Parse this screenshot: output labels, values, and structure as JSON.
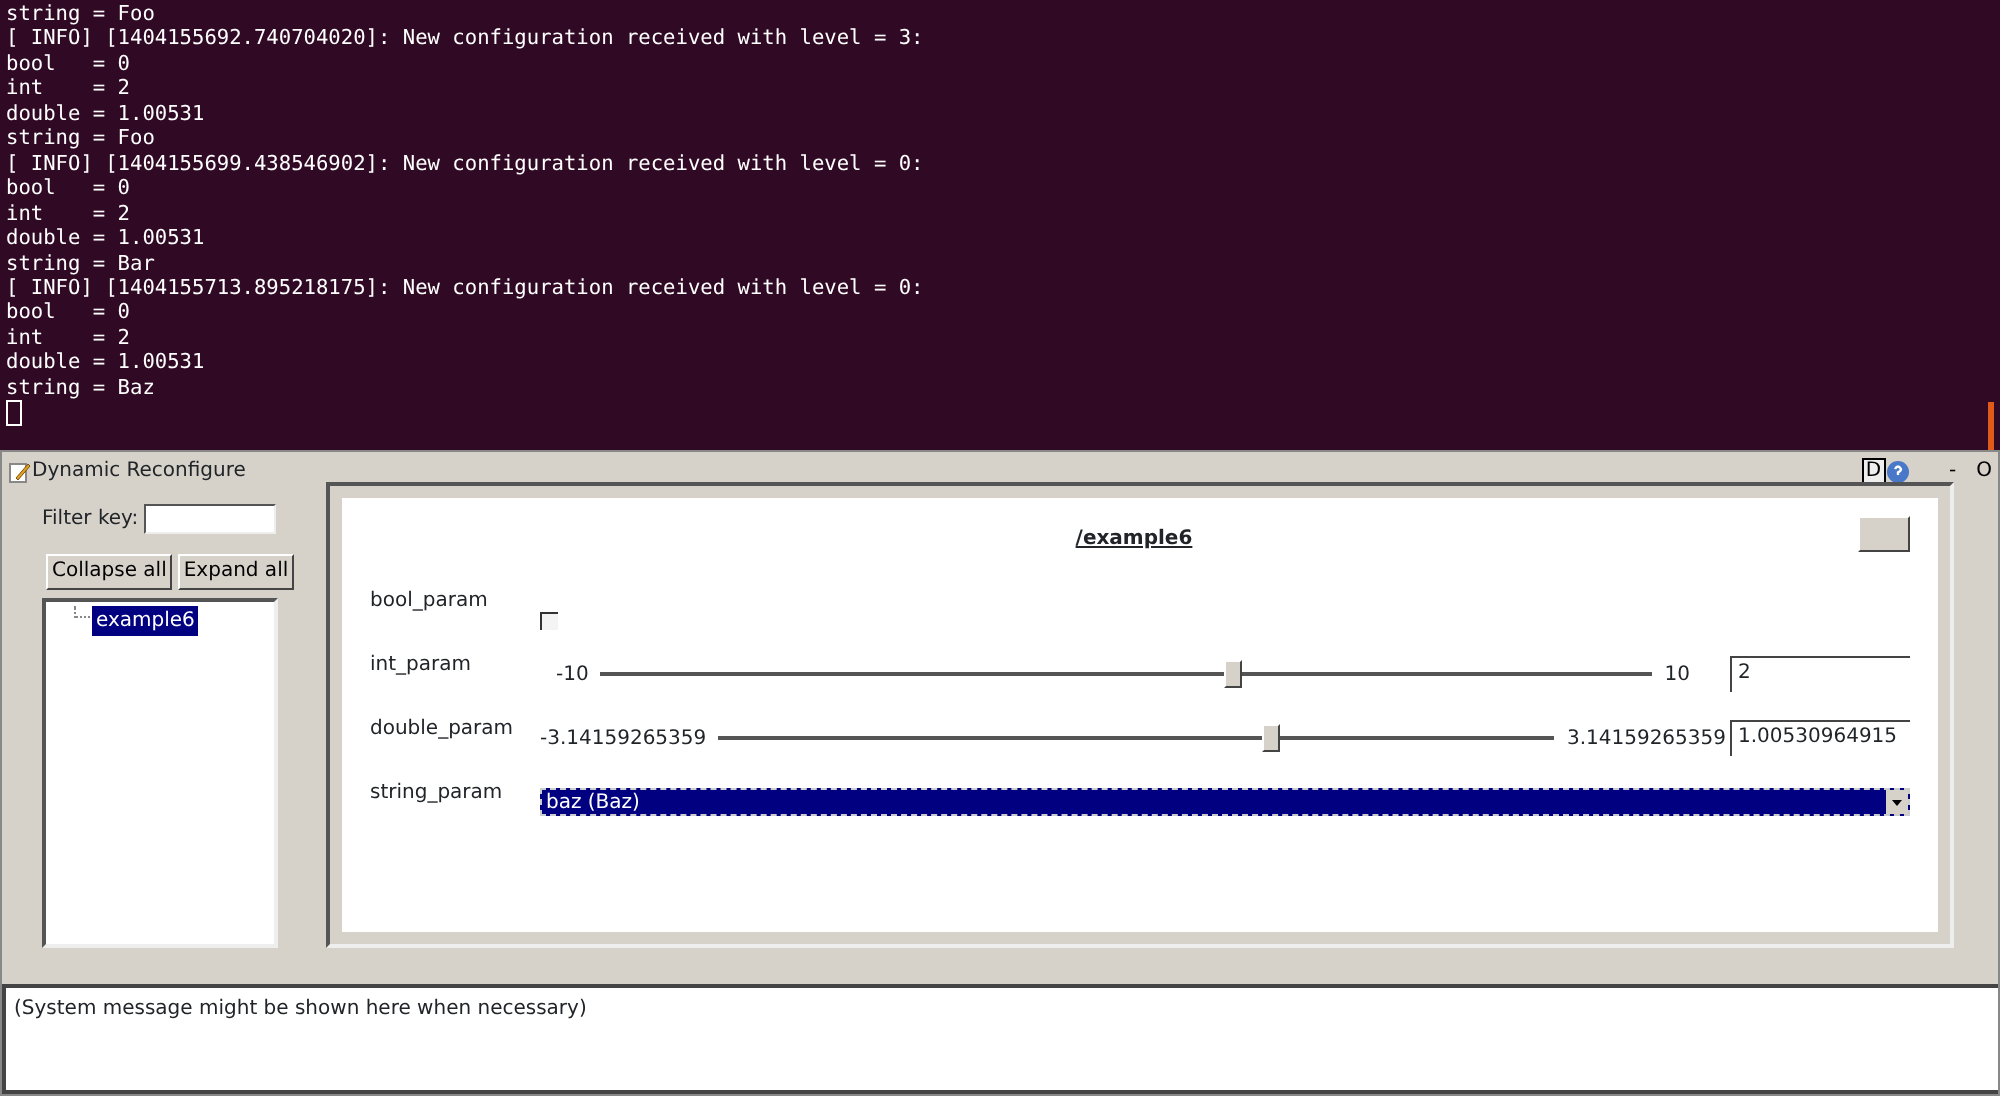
{
  "terminal": {
    "lines": [
      "string = Foo",
      "[ INFO] [1404155692.740704020]: New configuration received with level = 3:",
      "bool   = 0",
      "int    = 2",
      "double = 1.00531",
      "string = Foo",
      "[ INFO] [1404155699.438546902]: New configuration received with level = 0:",
      "bool   = 0",
      "int    = 2",
      "double = 1.00531",
      "string = Bar",
      "[ INFO] [1404155713.895218175]: New configuration received with level = 0:",
      "bool   = 0",
      "int    = 2",
      "double = 1.00531",
      "string = Baz"
    ]
  },
  "window": {
    "title": "Dynamic Reconfigure",
    "title_buttons": [
      "D",
      "-",
      "O"
    ]
  },
  "sidebar": {
    "filter_label": "Filter key:",
    "buttons": [
      "Collapse all",
      "Expand all"
    ],
    "tree": [
      {
        "label": "example6",
        "selected": true
      }
    ]
  },
  "panel": {
    "title": "/example6",
    "params": [
      {
        "kind": "checkbox",
        "name": "bool_param",
        "checked": false
      },
      {
        "kind": "slider",
        "name": "int_param",
        "min": "-10",
        "max": "10",
        "value": "2",
        "level": 0.6
      },
      {
        "kind": "slider",
        "name": "double_param",
        "min": "-3.14159265359",
        "max": "3.14159265359",
        "value": "1.00530964915",
        "level": 0.66
      },
      {
        "kind": "select",
        "name": "string_param",
        "value": "baz (Baz)"
      }
    ]
  },
  "status_bar": {
    "message": "(System message might be shown here when necessary)"
  }
}
